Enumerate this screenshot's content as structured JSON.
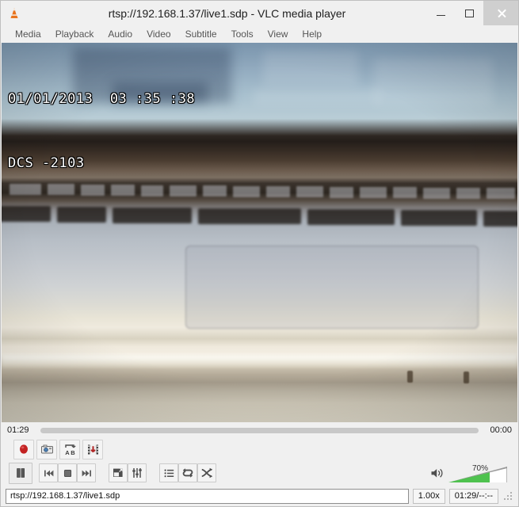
{
  "window": {
    "title": "rtsp://192.168.1.37/live1.sdp - VLC media player",
    "app_icon": "vlc-cone-icon",
    "minimize_label": "–",
    "maximize_label": "□",
    "close_label": "×"
  },
  "menubar": {
    "items": [
      {
        "label": "Media"
      },
      {
        "label": "Playback"
      },
      {
        "label": "Audio"
      },
      {
        "label": "Video"
      },
      {
        "label": "Subtitle"
      },
      {
        "label": "Tools"
      },
      {
        "label": "View"
      },
      {
        "label": "Help"
      }
    ]
  },
  "video": {
    "osd_line1": "01/01/2013  03 :35 :38",
    "osd_line2": "DCS -2103",
    "description": "Blurry webcam view of a white laptop keyboard, trackpad and front edge with a bluish glowing screen at the top"
  },
  "seek": {
    "elapsed": "01:29",
    "total": "00:00",
    "progress_percent": 0
  },
  "advanced_controls": {
    "record_label": "Record",
    "snapshot_label": "Take snapshot",
    "ab_loop_label": "Loop from point A to point B continuously",
    "frame_label": "Frame by frame"
  },
  "playback_controls": {
    "play_pause_label": "Pause",
    "previous_label": "Previous media in playlist",
    "stop_label": "Stop playback",
    "next_label": "Next media in playlist",
    "fullscreen_label": "Toggle the video in fullscreen",
    "extended_label": "Show extended settings",
    "playlist_label": "Show playlist",
    "loop_label": "Click to toggle between loop all, loop one and no loop",
    "shuffle_label": "Random"
  },
  "volume": {
    "mute_icon_label": "speaker-icon",
    "percent_label": "70%",
    "level": 70
  },
  "statusbar": {
    "current_url": "rtsp://192.168.1.37/live1.sdp",
    "speed": "1.00x",
    "time": "01:29/--:--"
  },
  "colors": {
    "accent_green": "#4ec24e",
    "record_red": "#cc2222",
    "window_bg": "#f0f0f0",
    "seek_trough": "#c8c8c8"
  }
}
